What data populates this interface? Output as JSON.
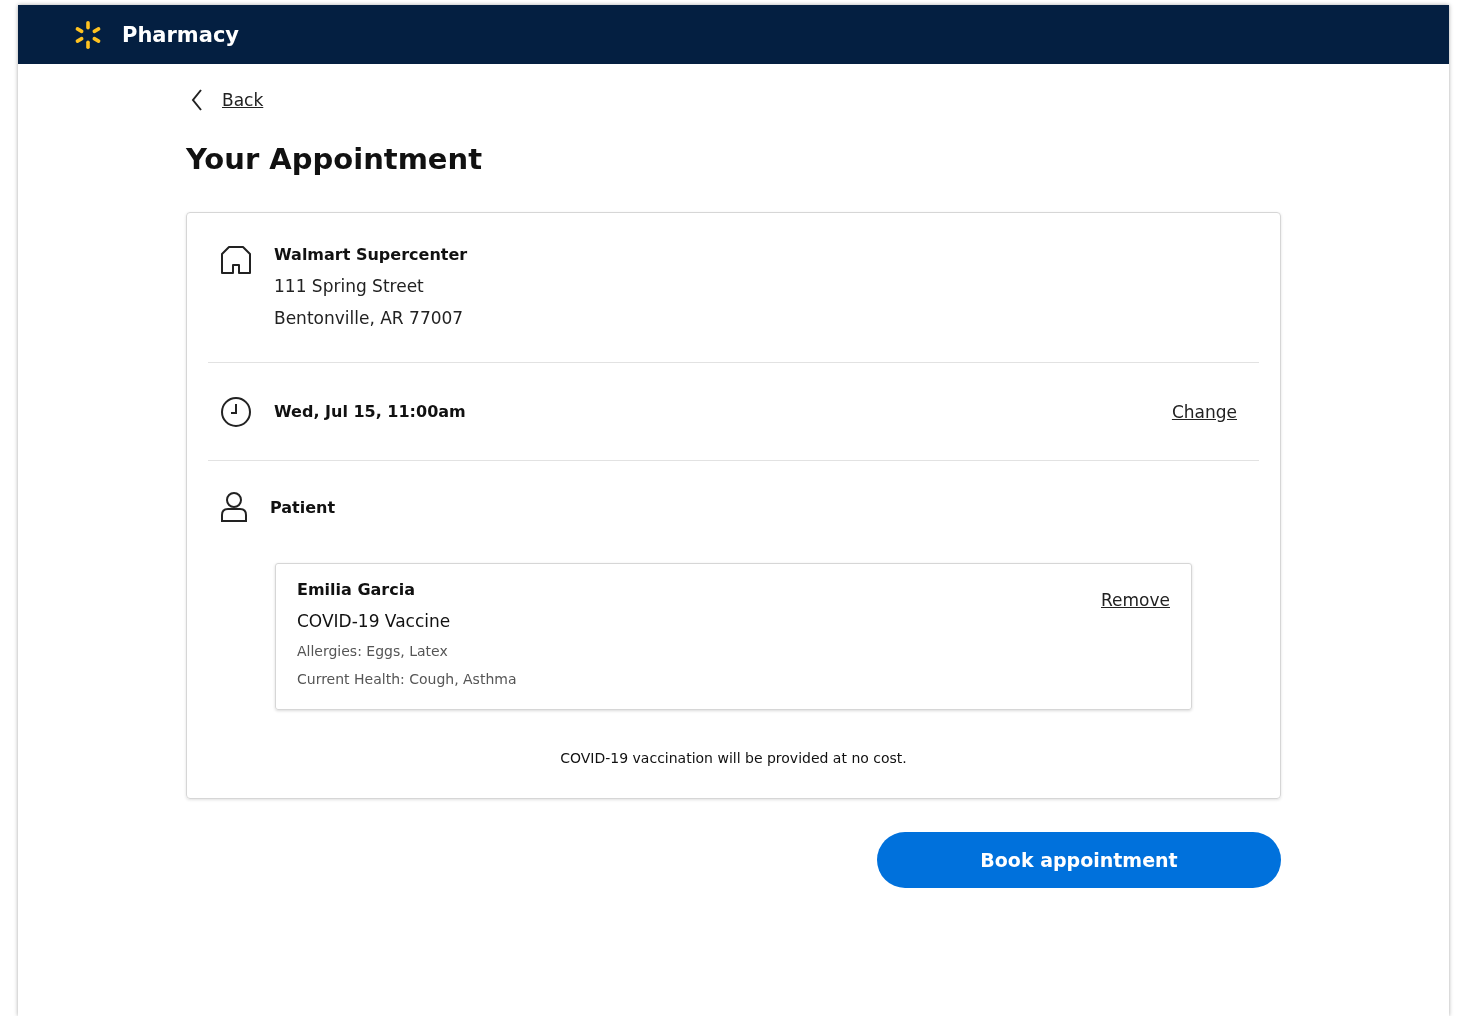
{
  "header": {
    "title": "Pharmacy"
  },
  "back_link": "Back",
  "page_title": "Your Appointment",
  "store": {
    "name": "Walmart Supercenter",
    "address_lines": [
      "111 Spring Street",
      "Bentonville, AR 77007"
    ]
  },
  "time": {
    "label": "Wed, Jul 15, 11:00am",
    "action": "Change"
  },
  "patient_section": {
    "label": "Patient"
  },
  "patients": [
    {
      "name": "Emilia Garcia",
      "service": "COVID-19 Vaccine",
      "details": [
        "Allergies: Eggs, Latex",
        "Current Health: Cough, Asthma"
      ],
      "action": "Remove"
    }
  ],
  "note": "COVID-19 vaccination will be provided at no cost.",
  "primary_button": "Book appointment"
}
